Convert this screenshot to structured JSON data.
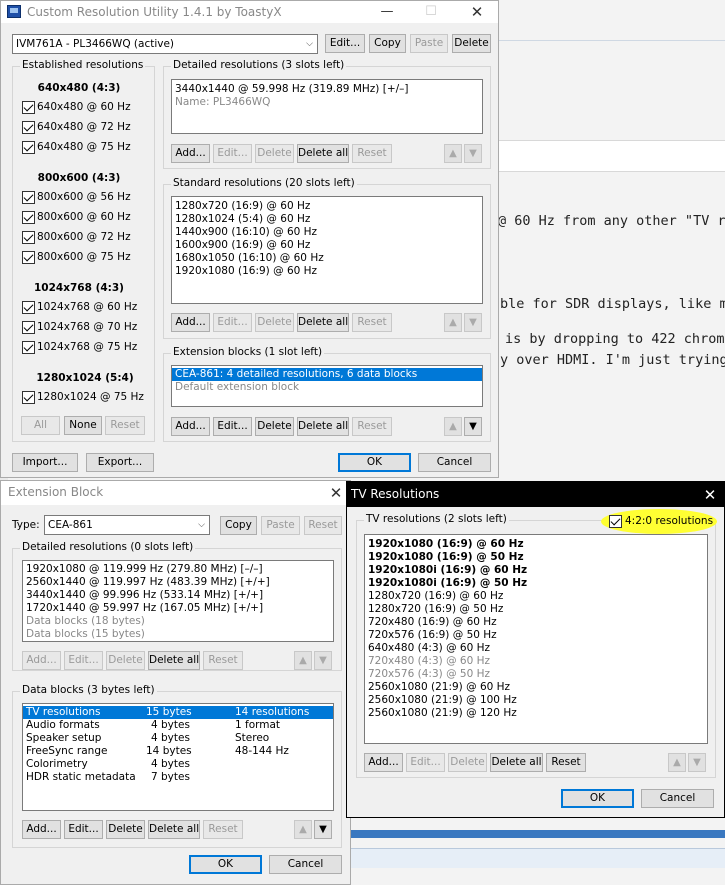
{
  "background": {
    "text1": "@ 60 Hz from any other \"TV res",
    "text2": "ble for SDR displays, like my DL",
    "text3": "is by dropping to 422 chroma c",
    "text4": "y over HDMI. I'm just trying to"
  },
  "main": {
    "title": "Custom Resolution Utility 1.4.1 by ToastyX",
    "monitor": "IVM761A - PL3466WQ (active)",
    "top_buttons": [
      "Edit...",
      "Copy",
      "Paste",
      "Delete"
    ],
    "established": {
      "label": "Established resolutions",
      "groups": [
        {
          "header": "640x480 (4:3)",
          "items": [
            "640x480 @ 60 Hz",
            "640x480 @ 72 Hz",
            "640x480 @ 75 Hz"
          ]
        },
        {
          "header": "800x600 (4:3)",
          "items": [
            "800x600 @ 56 Hz",
            "800x600 @ 60 Hz",
            "800x600 @ 72 Hz",
            "800x600 @ 75 Hz"
          ]
        },
        {
          "header": "1024x768 (4:3)",
          "items": [
            "1024x768 @ 60 Hz",
            "1024x768 @ 70 Hz",
            "1024x768 @ 75 Hz"
          ]
        },
        {
          "header": "1280x1024 (5:4)",
          "items": [
            "1280x1024 @ 75 Hz"
          ]
        }
      ],
      "buttons": [
        "All",
        "None",
        "Reset"
      ]
    },
    "detailed": {
      "label": "Detailed resolutions (3 slots left)",
      "items": [
        "3440x1440 @ 59.998 Hz (319.89 MHz) [+/–]",
        "Name: PL3466WQ"
      ]
    },
    "standard": {
      "label": "Standard resolutions (20 slots left)",
      "items": [
        "1280x720 (16:9) @ 60 Hz",
        "1280x1024 (5:4) @ 60 Hz",
        "1440x900 (16:10) @ 60 Hz",
        "1600x900 (16:9) @ 60 Hz",
        "1680x1050 (16:10) @ 60 Hz",
        "1920x1080 (16:9) @ 60 Hz"
      ]
    },
    "extension": {
      "label": "Extension blocks (1 slot left)",
      "items": [
        "CEA-861: 4 detailed resolutions, 6 data blocks",
        "Default extension block"
      ]
    },
    "list_buttons": [
      "Add...",
      "Edit...",
      "Delete",
      "Delete all",
      "Reset"
    ],
    "import": "Import...",
    "export": "Export...",
    "ok": "OK",
    "cancel": "Cancel"
  },
  "ext": {
    "title": "Extension Block",
    "type_label": "Type:",
    "type_value": "CEA-861",
    "type_buttons": [
      "Copy",
      "Paste",
      "Reset"
    ],
    "detailed_label": "Detailed resolutions (0 slots left)",
    "detailed_items": [
      "1920x1080 @ 119.999 Hz (279.80 MHz) [–/–]",
      "2560x1440 @ 119.997 Hz (483.39 MHz) [+/+]",
      "3440x1440 @ 99.996 Hz (533.14 MHz) [+/+]",
      "1720x1440 @ 59.997 Hz (167.05 MHz) [+/+]",
      "Data blocks (18 bytes)",
      "Data blocks (15 bytes)"
    ],
    "data_label": "Data blocks (3 bytes left)",
    "data_rows": [
      {
        "name": "TV resolutions",
        "size": "15 bytes",
        "info": "14 resolutions"
      },
      {
        "name": "Audio formats",
        "size": "4 bytes",
        "info": "1 format"
      },
      {
        "name": "Speaker setup",
        "size": "4 bytes",
        "info": "Stereo"
      },
      {
        "name": "FreeSync range",
        "size": "14 bytes",
        "info": "48-144 Hz"
      },
      {
        "name": "Colorimetry",
        "size": "4 bytes",
        "info": ""
      },
      {
        "name": "HDR static metadata",
        "size": "7 bytes",
        "info": ""
      }
    ],
    "ok": "OK",
    "cancel": "Cancel"
  },
  "tv": {
    "title": "TV Resolutions",
    "label": "TV resolutions (2 slots left)",
    "checkbox_label": "4:2:0 resolutions",
    "highlight_color": "#ffff33",
    "items": [
      "1920x1080 (16:9) @ 60 Hz",
      "1920x1080 (16:9) @ 50 Hz",
      "1920x1080i (16:9) @ 60 Hz",
      "1920x1080i (16:9) @ 50 Hz",
      "1280x720 (16:9) @ 60 Hz",
      "1280x720 (16:9) @ 50 Hz",
      "720x480 (16:9) @ 60 Hz",
      "720x576 (16:9) @ 50 Hz",
      "640x480 (4:3) @ 60 Hz",
      "720x480 (4:3) @ 60 Hz",
      "720x576 (4:3) @ 50 Hz",
      "2560x1080 (21:9) @ 60 Hz",
      "2560x1080 (21:9) @ 100 Hz",
      "2560x1080 (21:9) @ 120 Hz"
    ],
    "buttons": [
      "Add...",
      "Edit...",
      "Delete",
      "Delete all",
      "Reset"
    ],
    "ok": "OK",
    "cancel": "Cancel"
  }
}
